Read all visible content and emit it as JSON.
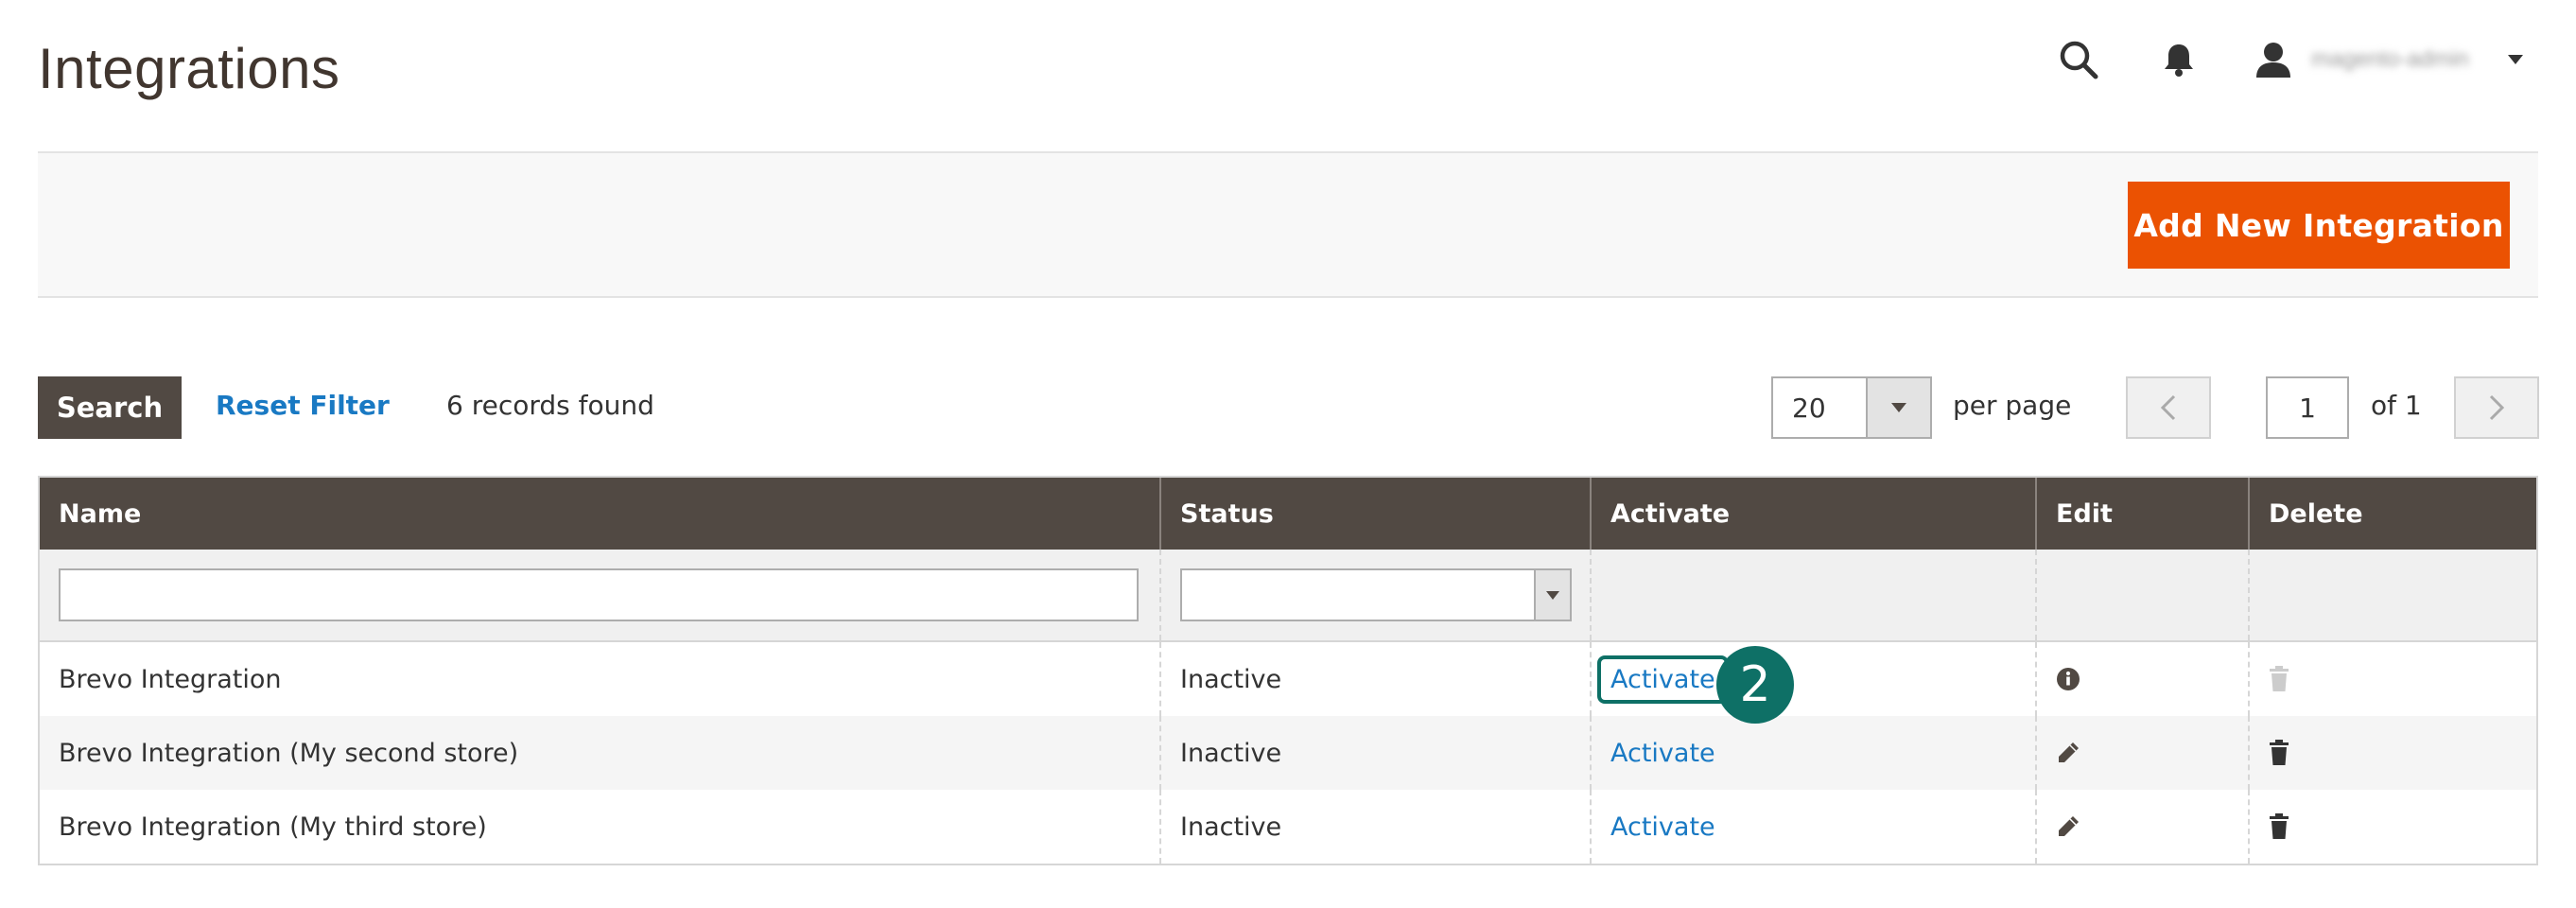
{
  "page": {
    "title": "Integrations"
  },
  "header": {
    "user_name": "magento-admin"
  },
  "actions": {
    "add_button": "Add New Integration"
  },
  "toolbar": {
    "search_button": "Search",
    "reset_filter": "Reset Filter",
    "records_found": "6 records found",
    "per_page_value": "20",
    "per_page_label": "per page",
    "current_page": "1",
    "of_pages": "of 1"
  },
  "grid": {
    "columns": [
      "Name",
      "Status",
      "Activate",
      "Edit",
      "Delete"
    ],
    "rows": [
      {
        "name": "Brevo Integration",
        "status": "Inactive",
        "activate": "Activate",
        "edit_icon": "info-icon",
        "delete_icon": "trash-icon-disabled"
      },
      {
        "name": "Brevo Integration (My second store)",
        "status": "Inactive",
        "activate": "Activate",
        "edit_icon": "pencil-icon",
        "delete_icon": "trash-icon"
      },
      {
        "name": "Brevo Integration (My third store)",
        "status": "Inactive",
        "activate": "Activate",
        "edit_icon": "pencil-icon",
        "delete_icon": "trash-icon"
      }
    ]
  },
  "annotation": {
    "step": "2"
  },
  "colors": {
    "accent": "#eb5202",
    "header_dark": "#514943",
    "link": "#1979c3",
    "highlight": "#0e7066"
  }
}
